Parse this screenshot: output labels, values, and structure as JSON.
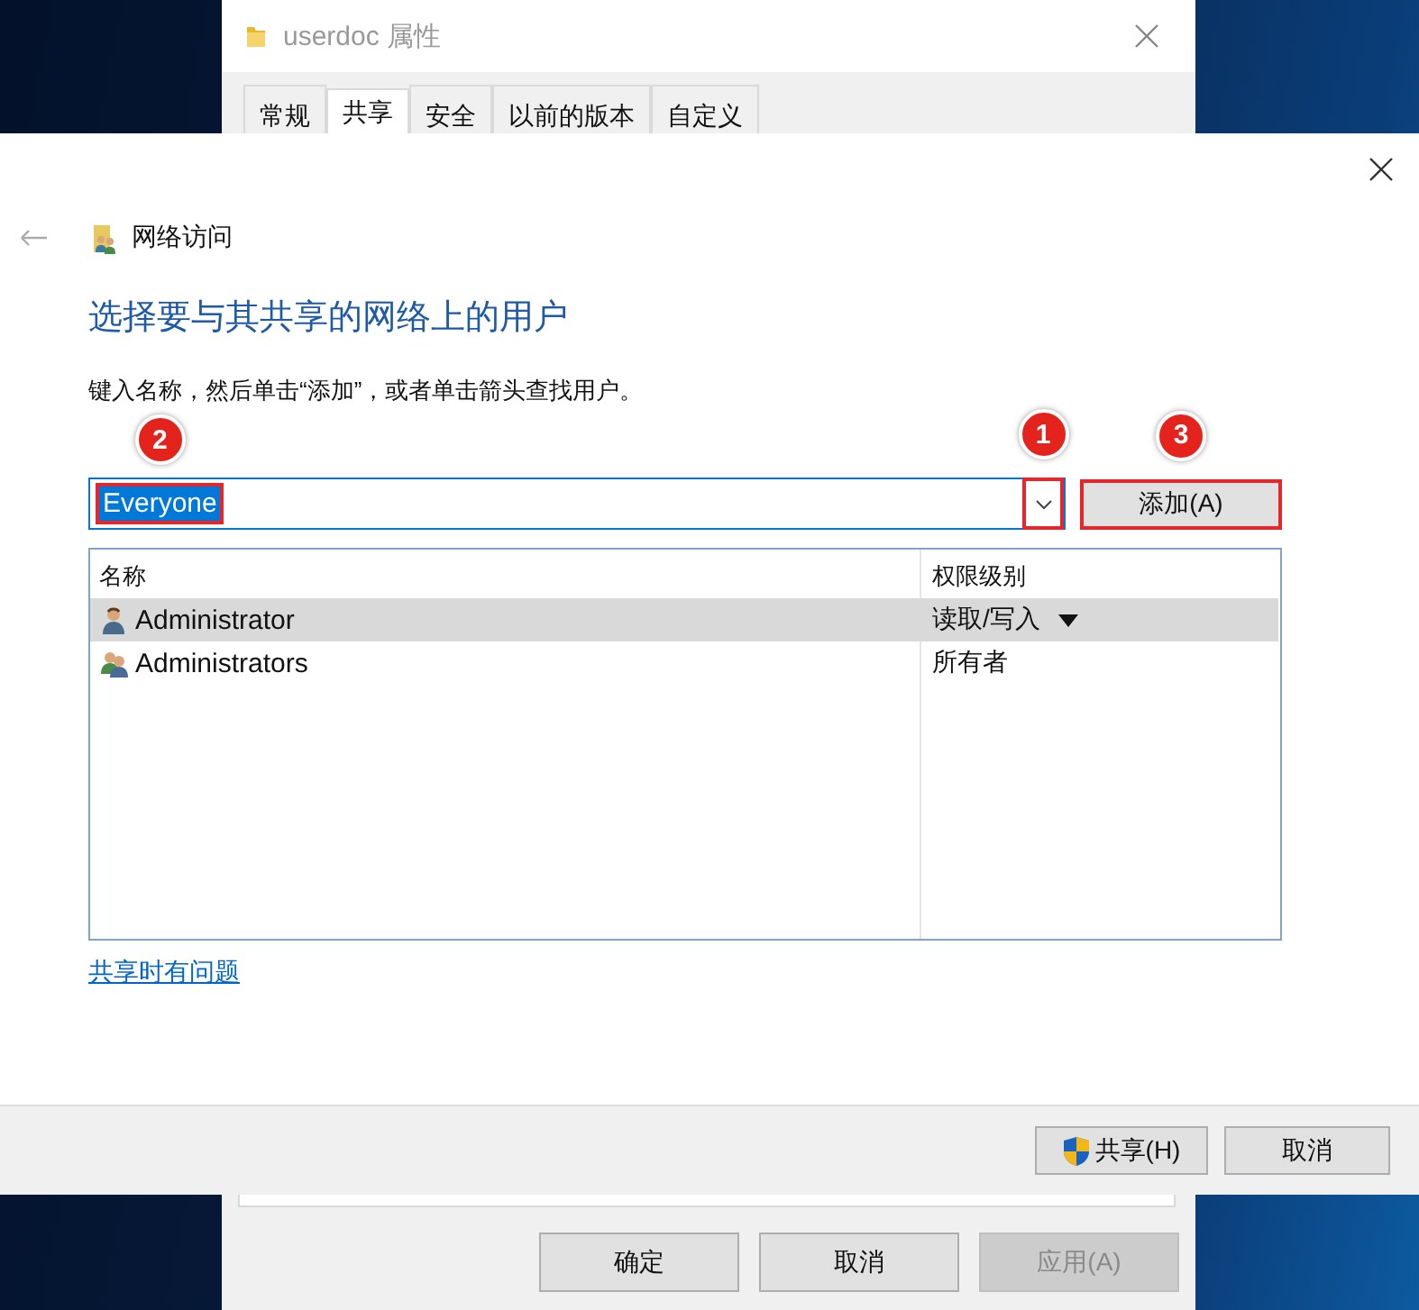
{
  "background_window": {
    "title": "userdoc 属性",
    "tabs": [
      {
        "label": "常规",
        "selected": false
      },
      {
        "label": "共享",
        "selected": true
      },
      {
        "label": "安全",
        "selected": false
      },
      {
        "label": "以前的版本",
        "selected": false
      },
      {
        "label": "自定义",
        "selected": false
      }
    ],
    "buttons": [
      {
        "label": "确定",
        "disabled": false
      },
      {
        "label": "取消",
        "disabled": false
      },
      {
        "label": "应用(A)",
        "disabled": true
      }
    ]
  },
  "dialog": {
    "breadcrumb": "网络访问",
    "heading": "选择要与其共享的网络上的用户",
    "instruction": "键入名称，然后单击“添加”，或者单击箭头查找用户。",
    "name_field": {
      "value": "Everyone",
      "highlighted": true,
      "badge": "2"
    },
    "dropdown": {
      "highlighted": true,
      "badge": "1"
    },
    "add_button": {
      "label": "添加(A)",
      "highlighted": true,
      "badge": "3"
    },
    "table": {
      "columns": [
        "名称",
        "权限级别"
      ],
      "rows": [
        {
          "name": "Administrator",
          "permission": "读取/写入",
          "kind": "user",
          "selected": true
        },
        {
          "name": "Administrators",
          "permission": "所有者",
          "kind": "group",
          "selected": false
        }
      ]
    },
    "help_link": "共享时有问题",
    "buttons": [
      {
        "label": "共享(H)",
        "kind": "shield"
      },
      {
        "label": "取消",
        "kind": "plain"
      }
    ]
  }
}
